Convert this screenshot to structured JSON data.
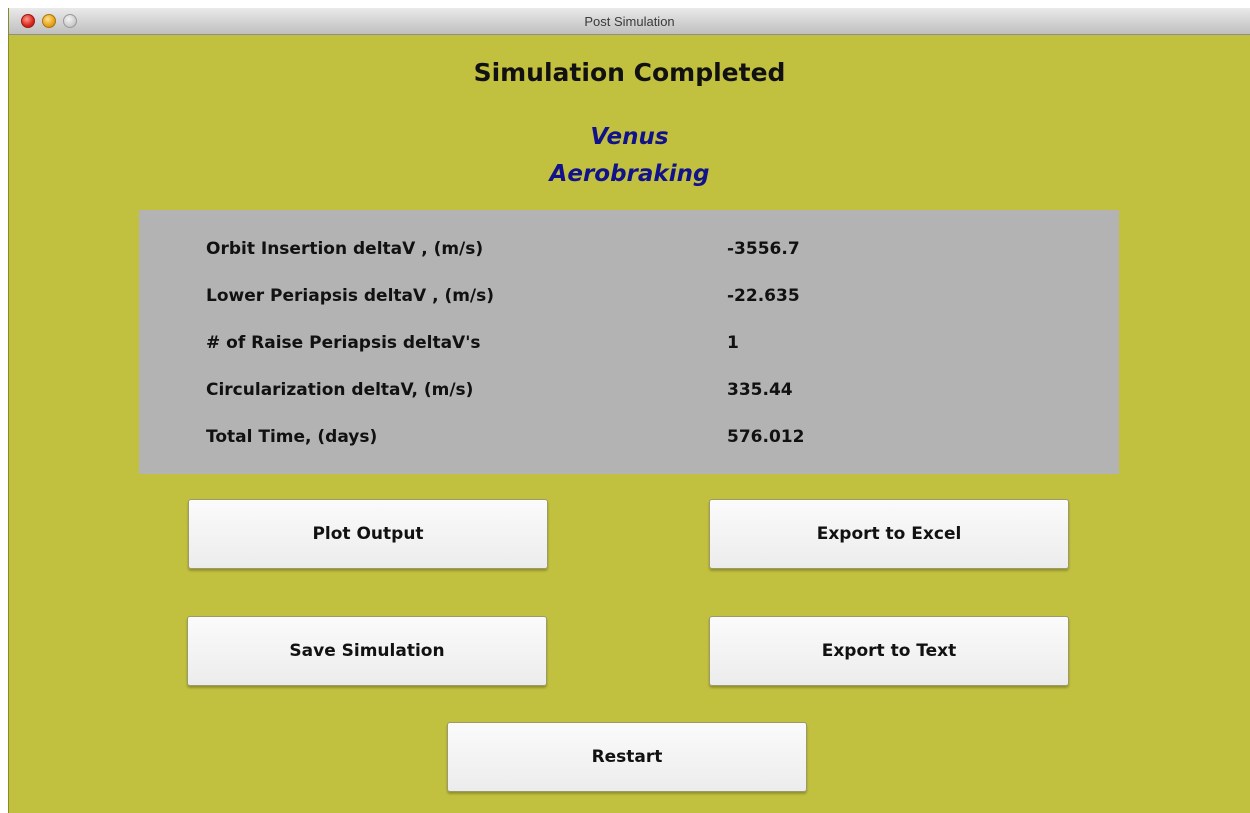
{
  "window": {
    "title": "Post Simulation"
  },
  "main": {
    "heading": "Simulation Completed",
    "subtitle_line1": "Venus",
    "subtitle_line2": "Aerobraking"
  },
  "results": [
    {
      "label": "Orbit Insertion deltaV , (m/s)",
      "value": "-3556.7"
    },
    {
      "label": "Lower Periapsis deltaV , (m/s)",
      "value": "-22.635"
    },
    {
      "label": "# of Raise Periapsis deltaV's",
      "value": "1"
    },
    {
      "label": "Circularization deltaV, (m/s)",
      "value": "335.44"
    },
    {
      "label": "Total Time, (days)",
      "value": "576.012"
    }
  ],
  "buttons": {
    "plot_output": "Plot Output",
    "export_excel": "Export to Excel",
    "save_simulation": "Save Simulation",
    "export_text": "Export to Text",
    "restart": "Restart"
  },
  "colors": {
    "background": "#c2c13f",
    "panel": "#b3b3b3",
    "subtitle": "#12128a"
  }
}
